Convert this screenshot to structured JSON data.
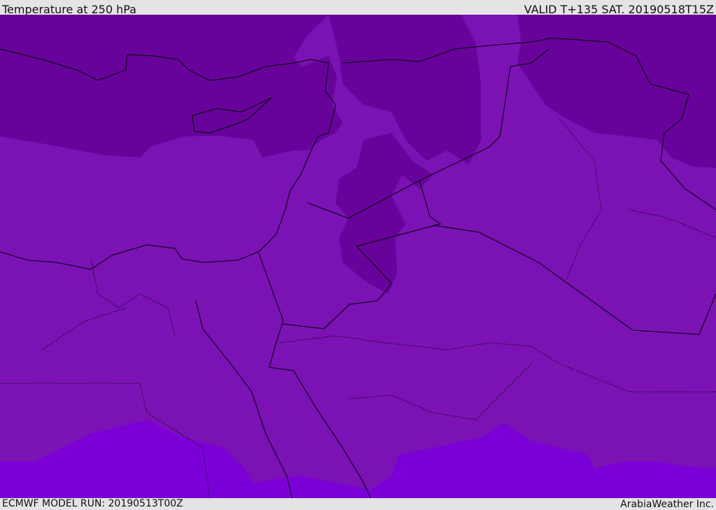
{
  "header": {
    "title": "Temperature at 250 hPa",
    "valid": "VALID T+135 SAT. 20190518T15Z"
  },
  "footer": {
    "model_run": "ECMWF MODEL RUN: 20190513T00Z",
    "credit": "ArabiaWeather Inc."
  },
  "colors": {
    "mid": "#7a12b4",
    "cold": "#67039a",
    "warm": "#7b00d8",
    "border": "#000000"
  }
}
